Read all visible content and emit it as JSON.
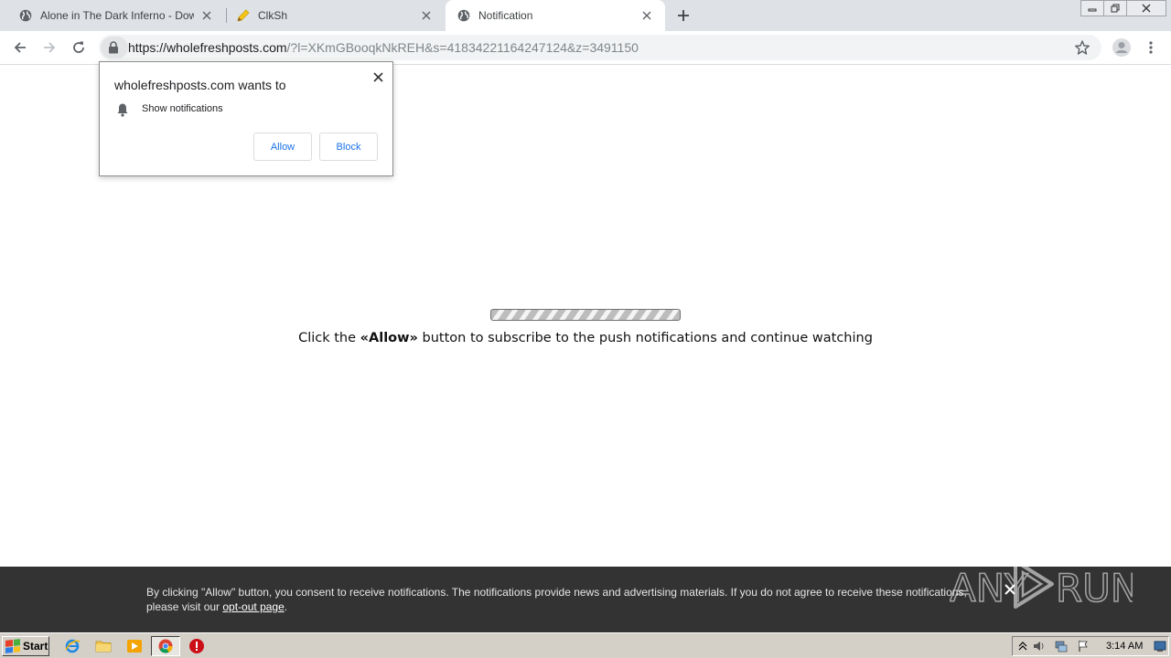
{
  "tabs": [
    {
      "title": "Alone in The Dark Inferno - Downloa",
      "icon": "globe-icon",
      "active": false
    },
    {
      "title": "ClkSh",
      "icon": "pencil-icon",
      "active": false
    },
    {
      "title": "Notification",
      "icon": "globe-icon",
      "active": true
    }
  ],
  "omnibox": {
    "host": "https://wholefreshposts.com",
    "path": "/?l=XKmGBooqkNkREH&s=41834221164247124&z=3491150"
  },
  "permission": {
    "title": "wholefreshposts.com wants to",
    "item": "Show notifications",
    "allow": "Allow",
    "block": "Block"
  },
  "page": {
    "instruction_before": "Click the ",
    "instruction_bold": "«Allow»",
    "instruction_after": " button to subscribe to the push notifications and continue watching"
  },
  "consent": {
    "text": "By clicking \"Allow\" button, you consent to receive notifications. The notifications provide news and advertising materials. If you do not agree to receive these notifications, please visit our ",
    "link": "opt-out page",
    "end": "."
  },
  "watermark": "ANY RUN",
  "taskbar": {
    "start": "Start",
    "clock": "3:14 AM"
  },
  "colors": {
    "accent": "#1a73e8",
    "tabstrip": "#dee1e6",
    "consent_bg": "#333333",
    "taskbar": "#d4d0c8"
  }
}
